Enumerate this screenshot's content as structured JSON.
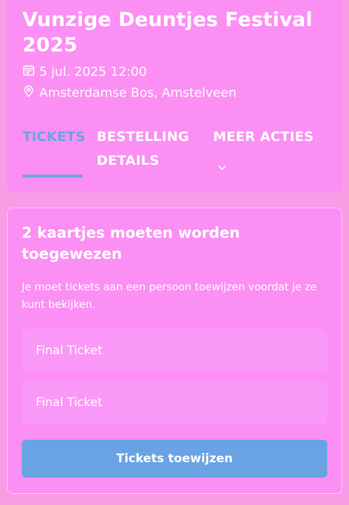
{
  "event": {
    "title": "Vunzige Deuntjes Festival 2025",
    "date": "5 jul. 2025 12:00",
    "location": "Amsterdamse Bos, Amstelveen"
  },
  "tabs": [
    {
      "label": "TICKETS",
      "active": true
    },
    {
      "label": "BESTELLING DETAILS",
      "active": false
    },
    {
      "label": "MEER ACTIES",
      "active": false
    }
  ],
  "assign": {
    "heading": "2 kaartjes moeten worden toegewezen",
    "description": "Je moet tickets aan een persoon toewijzen voordat je ze kunt bekijken.",
    "tickets": [
      "Final Ticket",
      "Final Ticket"
    ],
    "button_label": "Tickets toewijzen"
  },
  "colors": {
    "background": "#f79de6",
    "card": "#fb8ff3",
    "accent": "#6aa3e3",
    "text": "#ffffff"
  },
  "icons": {
    "date": "calendar-icon",
    "location": "map-pin-icon",
    "more": "chevron-down-icon"
  }
}
